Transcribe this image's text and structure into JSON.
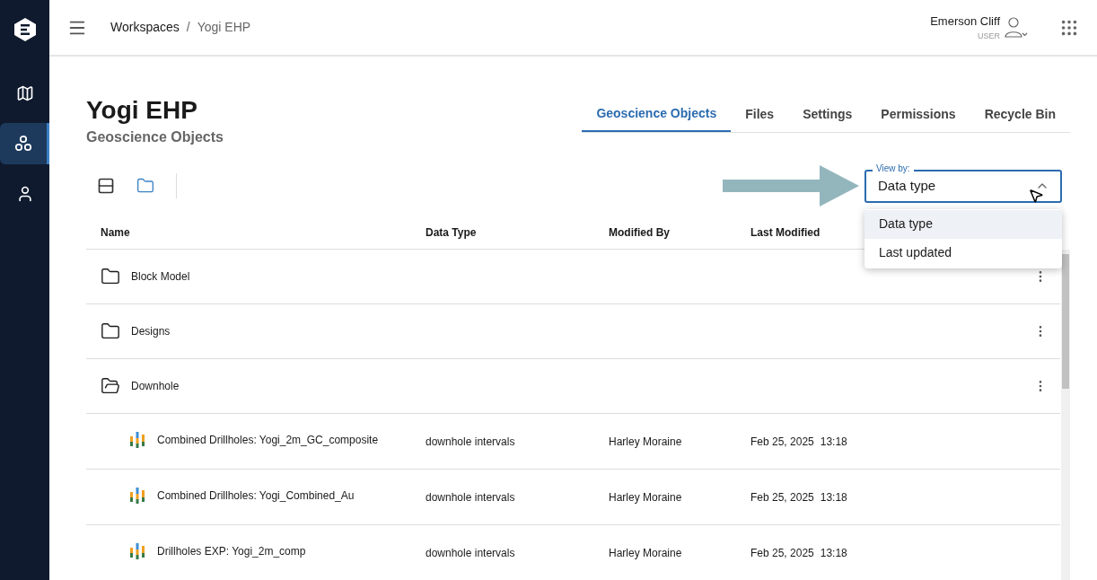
{
  "sidebar": {
    "items": [
      {
        "selected": false
      },
      {
        "selected": true
      },
      {
        "selected": false
      }
    ]
  },
  "breadcrumb": [
    "Workspaces",
    "/",
    "Yogi EHP"
  ],
  "user": {
    "name": "Emerson Cliff",
    "role": "USER"
  },
  "page": {
    "title": "Yogi EHP",
    "subtitle": "Geoscience Objects"
  },
  "tabs": [
    {
      "label": "Geoscience Objects",
      "selected": true
    },
    {
      "label": "Files",
      "selected": false
    },
    {
      "label": "Settings",
      "selected": false
    },
    {
      "label": "Permissions",
      "selected": false
    },
    {
      "label": "Recycle Bin",
      "selected": false
    }
  ],
  "view_toggle": [
    {
      "selected": false
    },
    {
      "selected": true
    }
  ],
  "view_by": {
    "label": "View by:",
    "value": "Data type",
    "expanded": true,
    "options": [
      {
        "label": "Data type",
        "selected": true
      },
      {
        "label": "Last updated",
        "selected": false
      }
    ]
  },
  "table": {
    "columns": [
      "Name",
      "Data Type",
      "Modified By",
      "Last Modified"
    ],
    "rows": [
      {
        "kind": "folder",
        "name": "Block Model",
        "expanded": false
      },
      {
        "kind": "folder",
        "name": "Designs",
        "expanded": false
      },
      {
        "kind": "folder",
        "name": "Downhole",
        "expanded": true
      },
      {
        "kind": "object",
        "name": "Combined Drillholes: Yogi_2m_GC_composite",
        "data_type": "downhole intervals",
        "modified_by": "Harley Moraine",
        "date": "Feb 25, 2025",
        "time": "13:18"
      },
      {
        "kind": "object",
        "name": "Combined Drillholes: Yogi_Combined_Au",
        "data_type": "downhole intervals",
        "modified_by": "Harley Moraine",
        "date": "Feb 25, 2025",
        "time": "13:18"
      },
      {
        "kind": "object",
        "name": "Drillholes EXP: Yogi_2m_comp",
        "data_type": "downhole intervals",
        "modified_by": "Harley Moraine",
        "date": "Feb 25, 2025",
        "time": "13:18"
      }
    ]
  }
}
